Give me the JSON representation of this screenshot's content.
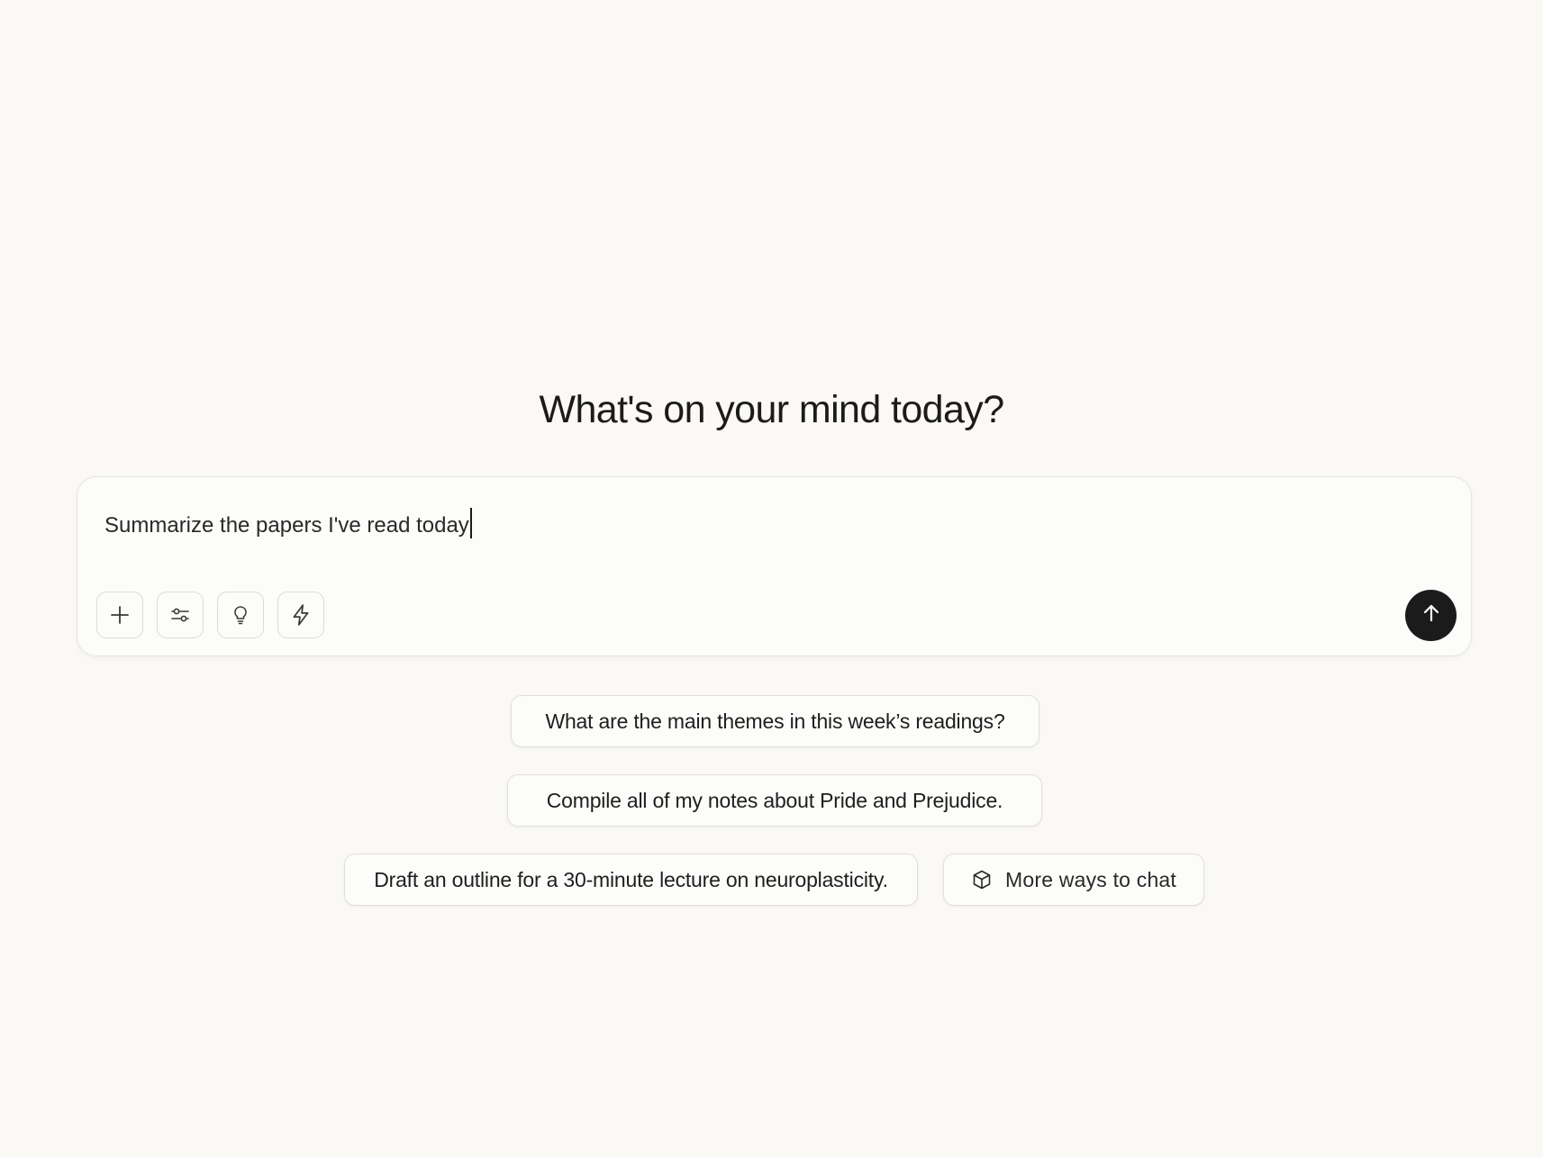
{
  "main": {
    "heading": "What's on your mind today?"
  },
  "composer": {
    "input_value": "Summarize the papers I've read today",
    "tools": [
      {
        "name": "add-button",
        "icon": "plus-icon"
      },
      {
        "name": "settings-button",
        "icon": "sliders-icon"
      },
      {
        "name": "ideas-button",
        "icon": "lightbulb-icon"
      },
      {
        "name": "quick-button",
        "icon": "lightning-icon"
      }
    ],
    "mic_icon": "microphone-icon",
    "send_icon": "arrow-up-icon"
  },
  "suggestions": [
    {
      "label": "What are the main themes in this week’s readings?"
    },
    {
      "label": "Compile all of my notes about Pride and Prejudice."
    },
    {
      "label": "Draft an outline for a 30-minute lecture on neuroplasticity."
    }
  ],
  "more_ways": {
    "label": "More ways to chat",
    "icon": "cube-icon"
  },
  "colors": {
    "background": "#faf9f6",
    "send_button": "#1b1b1b",
    "border": "#e2e0da"
  }
}
